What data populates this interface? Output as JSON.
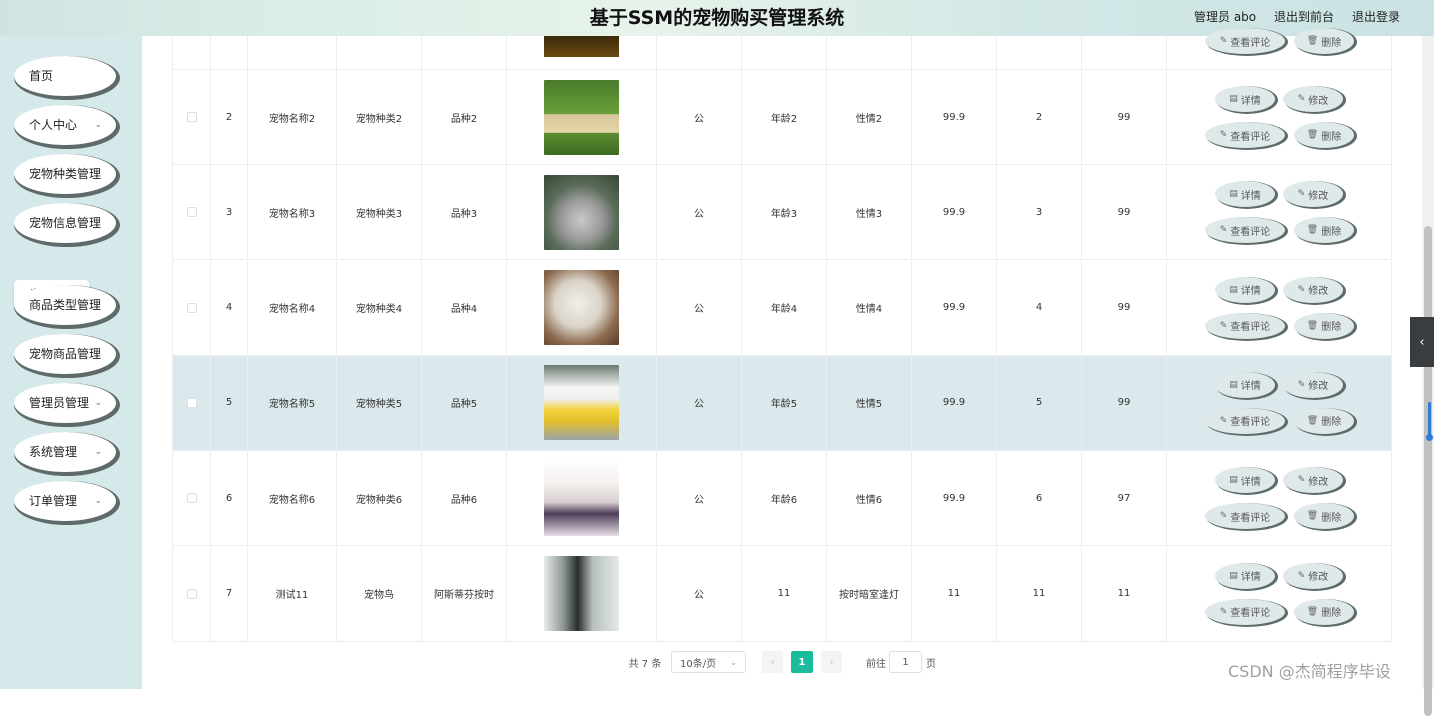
{
  "header": {
    "title": "基于SSM的宠物购买管理系统",
    "user": "管理员 abo",
    "front_link": "退出到前台",
    "logout": "退出登录"
  },
  "sidebar": {
    "items": [
      {
        "label": "首页",
        "chevron": false
      },
      {
        "label": "个人中心",
        "chevron": true
      },
      {
        "label": "宠物种类管理",
        "chevron": false
      },
      {
        "label": "宠物信息管理",
        "chevron": false
      },
      {
        "label": "商品类型管理",
        "chevron": false
      },
      {
        "label": "宠物商品管理",
        "chevron": false
      },
      {
        "label": "管理员管理",
        "chevron": true
      },
      {
        "label": "系统管理",
        "chevron": true
      },
      {
        "label": "订单管理",
        "chevron": true
      }
    ],
    "sub_item": "宠物信息"
  },
  "table": {
    "rows": [
      {
        "idx": "2",
        "name": "宠物名称2",
        "kind": "宠物种类2",
        "breed": "品种2",
        "sex": "公",
        "age": "年龄2",
        "temper": "性情2",
        "price": "99.9",
        "col_a": "2",
        "col_b": "99",
        "image": "puppy-grass-image"
      },
      {
        "idx": "3",
        "name": "宠物名称3",
        "kind": "宠物种类3",
        "breed": "品种3",
        "sex": "公",
        "age": "年龄3",
        "temper": "性情3",
        "price": "99.9",
        "col_a": "3",
        "col_b": "99",
        "image": "chinchilla-image"
      },
      {
        "idx": "4",
        "name": "宠物名称4",
        "kind": "宠物种类4",
        "breed": "品种4",
        "sex": "公",
        "age": "年龄4",
        "temper": "性情4",
        "price": "99.9",
        "col_a": "4",
        "col_b": "99",
        "image": "kitten-image"
      },
      {
        "idx": "5",
        "name": "宠物名称5",
        "kind": "宠物种类5",
        "breed": "品种5",
        "sex": "公",
        "age": "年龄5",
        "temper": "性情5",
        "price": "99.9",
        "col_a": "5",
        "col_b": "99",
        "image": "dog-yellow-coat-image"
      },
      {
        "idx": "6",
        "name": "宠物名称6",
        "kind": "宠物种类6",
        "breed": "品种6",
        "sex": "公",
        "age": "年龄6",
        "temper": "性情6",
        "price": "99.9",
        "col_a": "6",
        "col_b": "97",
        "image": "dog-dress-image"
      },
      {
        "idx": "7",
        "name": "测试11",
        "kind": "宠物鸟",
        "breed": "阿斯蒂芬按时",
        "sex": "公",
        "age": "11",
        "temper": "按时暗室逢灯",
        "price": "11",
        "col_a": "11",
        "col_b": "11",
        "image": "anime-character-image"
      }
    ],
    "actions": {
      "detail": "详情",
      "edit": "修改",
      "comments": "查看评论",
      "delete": "删除"
    }
  },
  "pagination": {
    "total": "共 7 条",
    "page_size": "10条/页",
    "current": "1",
    "goto_prefix": "前往",
    "goto_value": "1",
    "goto_suffix": "页"
  },
  "watermark": "CSDN @杰简程序毕设",
  "colors": {
    "accent": "#1abc9c",
    "sidebar_bg": "#d5e8ea",
    "highlight_row": "#dbe9ec"
  }
}
